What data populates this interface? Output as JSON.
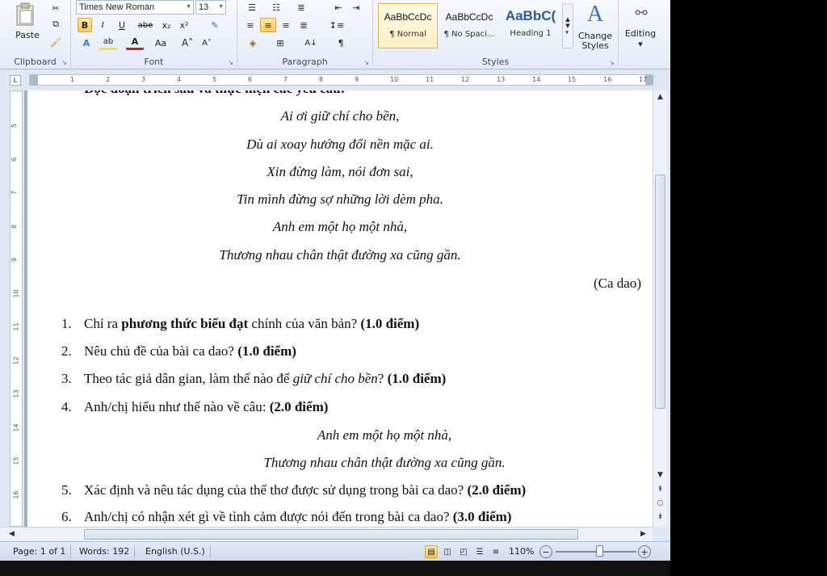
{
  "ribbon": {
    "clipboard": {
      "label": "Clipboard",
      "paste_label": "Paste"
    },
    "font": {
      "label": "Font",
      "font_name": "Times New Roman",
      "font_size": "13",
      "bold": "B",
      "italic": "I",
      "underline": "U",
      "strike": "abe",
      "subscript": "x₂",
      "superscript": "x²",
      "change_case": "Aa",
      "grow": "A˄",
      "shrink": "A˅"
    },
    "paragraph": {
      "label": "Paragraph"
    },
    "styles": {
      "label": "Styles",
      "items": [
        {
          "preview": "AaBbCcDc",
          "name": "¶ Normal"
        },
        {
          "preview": "AaBbCcDc",
          "name": "¶ No Spaci..."
        },
        {
          "preview": "AaBbC(",
          "name": "Heading 1"
        }
      ],
      "change_styles": "Change Styles"
    },
    "editing": {
      "label": "Editing"
    }
  },
  "ruler": {
    "tab_selector": "L",
    "numbers": [
      "1",
      "2",
      "3",
      "4",
      "5",
      "6",
      "7",
      "8",
      "9",
      "10",
      "11",
      "12",
      "13",
      "14",
      "15",
      "16",
      "17"
    ]
  },
  "vruler": {
    "numbers": [
      "5",
      "6",
      "7",
      "8",
      "9",
      "10",
      "11",
      "12",
      "13",
      "14",
      "15",
      "16"
    ]
  },
  "document": {
    "cut_heading": "Đọc đoạn trích sau và thực hiện các yêu cầu:",
    "poem1": [
      "Ai ơi giữ chí cho bền,",
      "Dù ai xoay hướng đổi nền mặc ai.",
      "Xin đừng làm, nói đơn sai,",
      "Tin mình đừng sợ những lời dèm pha.",
      "Anh em một họ một nhà,",
      "Thương nhau chân thật đường xa cũng gần."
    ],
    "source": "(Ca dao)",
    "q1": {
      "n": "1.",
      "a": "Chỉ ra ",
      "b": "phương thức biểu đạt",
      "c": " chính của văn bản? ",
      "pts": "(1.0 điểm)"
    },
    "q2": {
      "n": "2.",
      "a": "Nêu chủ đề của bài ca dao? ",
      "pts": "(1.0 điểm)"
    },
    "q3": {
      "n": "3.",
      "a": "Theo tác giả dân gian, làm thế nào để ",
      "i": "giữ chí cho bền",
      "c": "? ",
      "pts": "(1.0 điểm)"
    },
    "q4": {
      "n": "4.",
      "a": "Anh/chị hiểu như thế nào về câu: ",
      "pts": "(2.0 điểm)"
    },
    "poem2": [
      "Anh em một họ một nhà,",
      "Thương nhau chân thật đường xa cũng gần."
    ],
    "q5": {
      "n": "5.",
      "a": "Xác định và nêu tác dụng của thể thơ được sử dụng trong bài ca dao? ",
      "pts": "(2.0 điểm)"
    },
    "q6": {
      "n": "6.",
      "a": "Anh/chị có nhận xét gì về tình cảm được nói đến trong bài ca dao? ",
      "pts": "(3.0 điểm)"
    }
  },
  "status": {
    "page": "Page: 1 of 1",
    "words": "Words: 192",
    "language": "English (U.S.)",
    "zoom": "110%",
    "zoom_level": 0.55
  }
}
